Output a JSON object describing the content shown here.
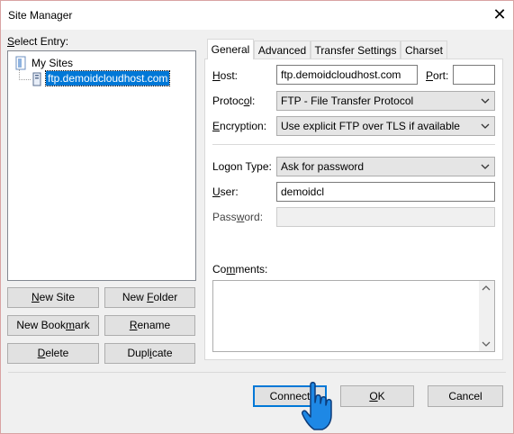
{
  "window": {
    "title": "Site Manager"
  },
  "left": {
    "select_entry_prefix": "S",
    "select_entry_rest": "elect Entry:",
    "tree": [
      {
        "label": "My Sites",
        "icon": "folder-icon"
      },
      {
        "label": "ftp.demoidcloudhost.com",
        "icon": "server-icon",
        "selected": true
      }
    ],
    "buttons": {
      "new_site_a": "N",
      "new_site_b": "ew Site",
      "new_folder_a": "New ",
      "new_folder_u": "F",
      "new_folder_b": "older",
      "new_bookmark_a": "New Book",
      "new_bookmark_u": "m",
      "new_bookmark_b": "ark",
      "rename_u": "R",
      "rename_b": "ename",
      "delete_u": "D",
      "delete_b": "elete",
      "duplicate_a": "Dupl",
      "duplicate_u": "i",
      "duplicate_b": "cate"
    }
  },
  "tabs": [
    "General",
    "Advanced",
    "Transfer Settings",
    "Charset"
  ],
  "general": {
    "host_u": "H",
    "host_b": "ost:",
    "host_value": "ftp.demoidcloudhost.com",
    "port_u": "P",
    "port_b": "ort:",
    "port_value": "",
    "protocol_a": "Protoc",
    "protocol_u": "o",
    "protocol_b": "l:",
    "protocol_value": "FTP - File Transfer Protocol",
    "encryption_u": "E",
    "encryption_b": "ncryption:",
    "encryption_value": "Use explicit FTP over TLS if available",
    "logon_a": "Logon Type:",
    "logon_value": "Ask for password",
    "user_u": "U",
    "user_b": "ser:",
    "user_value": "demoidcl",
    "password_a": "Pass",
    "password_u": "w",
    "password_b": "ord:",
    "comments_a": "Co",
    "comments_u": "m",
    "comments_b": "ments:"
  },
  "footer": {
    "connect_label": "Connect",
    "ok_u": "O",
    "ok_b": "K",
    "cancel_label": "Cancel"
  }
}
